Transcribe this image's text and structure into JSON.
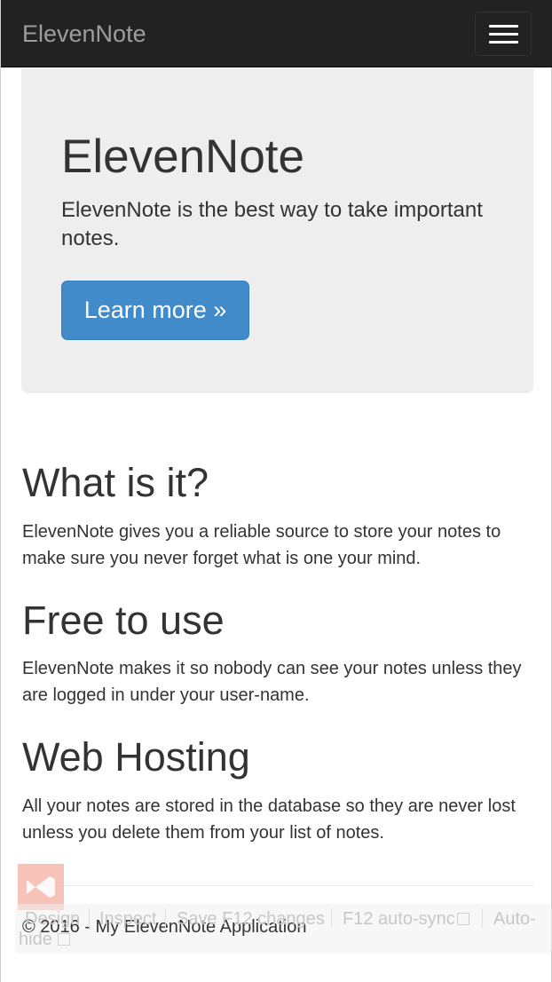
{
  "navbar": {
    "brand": "ElevenNote",
    "toggle_icon": "hamburger-icon"
  },
  "jumbotron": {
    "title": "ElevenNote",
    "lead": "ElevenNote is the best way to take important notes.",
    "button_label": "Learn more »"
  },
  "sections": [
    {
      "heading": "What is it?",
      "body": "ElevenNote gives you a reliable source to store your notes to make sure you never forget what is one your mind."
    },
    {
      "heading": "Free to use",
      "body": "ElevenNote makes it so nobody can see your notes unless they are logged in under your user-name."
    },
    {
      "heading": "Web Hosting",
      "body": "All your notes are stored in the database so they are never lost unless you delete them from your list of notes."
    }
  ],
  "footer": {
    "copyright": "© 2016 - My ElevenNote Application"
  },
  "browser_link": {
    "logo_icon": "visual-studio-icon",
    "design": "Design",
    "inspect": "Inspect",
    "save": "Save F12 changes",
    "auto_sync": "F12 auto-sync",
    "auto_hide_line1": "Auto-",
    "auto_hide_line2": "hide"
  },
  "colors": {
    "navbar_bg": "#222222",
    "brand_text": "#9d9d9d",
    "jumbotron_bg": "#eeeeee",
    "primary_button": "#428bca"
  }
}
